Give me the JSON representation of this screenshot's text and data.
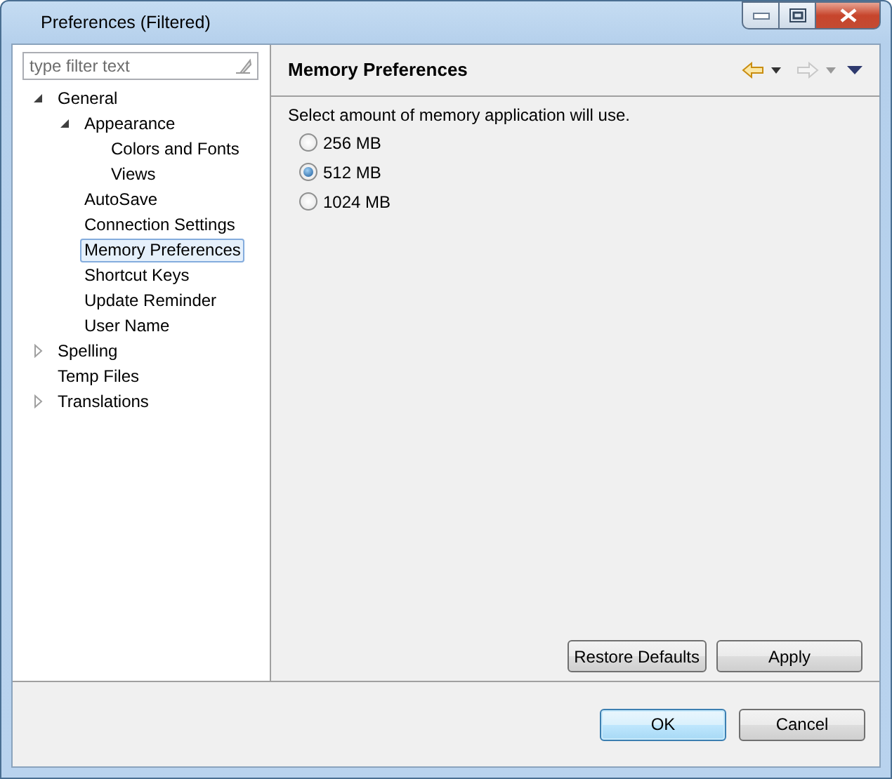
{
  "window": {
    "title": "Preferences (Filtered)"
  },
  "filter": {
    "placeholder": "type filter text"
  },
  "tree": [
    {
      "label": "General",
      "selected": false,
      "expanded": true,
      "children": [
        {
          "label": "Appearance",
          "selected": false,
          "expanded": true,
          "children": [
            {
              "label": "Colors and Fonts",
              "selected": false
            },
            {
              "label": "Views",
              "selected": false
            }
          ]
        },
        {
          "label": "AutoSave",
          "selected": false
        },
        {
          "label": "Connection Settings",
          "selected": false
        },
        {
          "label": "Memory Preferences",
          "selected": true
        },
        {
          "label": "Shortcut Keys",
          "selected": false
        },
        {
          "label": "Update Reminder",
          "selected": false
        },
        {
          "label": "User Name",
          "selected": false
        }
      ]
    },
    {
      "label": "Spelling",
      "selected": false,
      "expanded": false
    },
    {
      "label": "Temp Files",
      "selected": false
    },
    {
      "label": "Translations",
      "selected": false,
      "expanded": false
    }
  ],
  "page": {
    "title": "Memory Preferences",
    "description": "Select amount of memory application will use.",
    "options": [
      {
        "label": "256 MB",
        "selected": false
      },
      {
        "label": "512 MB",
        "selected": true
      },
      {
        "label": "1024 MB",
        "selected": false
      }
    ],
    "buttons": [
      "Restore Defaults",
      "Apply"
    ]
  },
  "dialog_buttons": [
    {
      "label": "OK",
      "kind": "default"
    },
    {
      "label": "Cancel",
      "kind": "normal"
    }
  ]
}
